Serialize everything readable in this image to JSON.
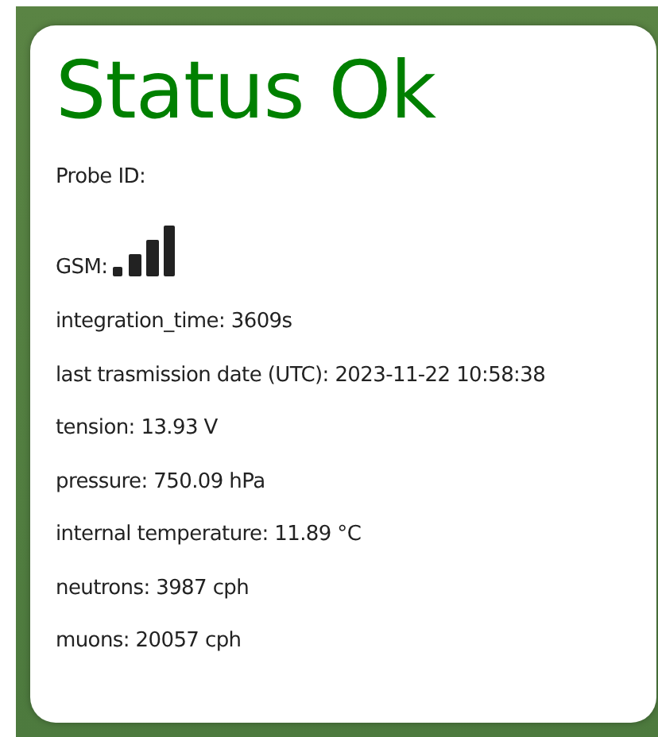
{
  "status": {
    "title": "Status Ok"
  },
  "probe_id": {
    "label": "Probe ID:"
  },
  "gsm": {
    "label": "GSM:"
  },
  "readings": [
    {
      "text": "integration_time: 3609s"
    },
    {
      "text": "last trasmission date (UTC): 2023-11-22 10:58:38"
    },
    {
      "text": "tension: 13.93 V"
    },
    {
      "text": "pressure: 750.09 hPa"
    },
    {
      "text": "internal temperature: 11.89 °C"
    },
    {
      "text": "neutrons: 3987 cph"
    },
    {
      "text": "muons: 20057 cph"
    }
  ]
}
